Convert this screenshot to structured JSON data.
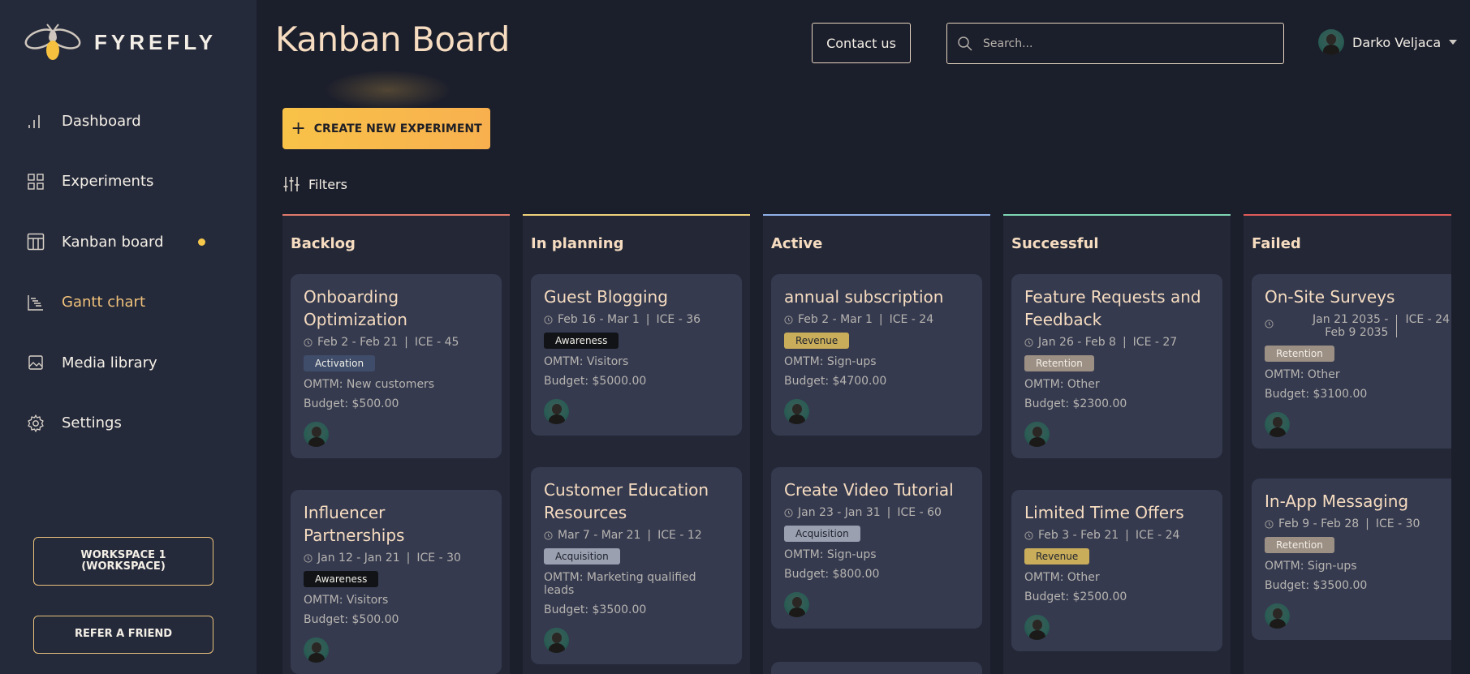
{
  "brand": {
    "name": "FYREFLY"
  },
  "sidebar": {
    "items": [
      {
        "label": "Dashboard",
        "icon": "bar-chart-icon"
      },
      {
        "label": "Experiments",
        "icon": "grid-icon"
      },
      {
        "label": "Kanban board",
        "icon": "kanban-icon",
        "active": true
      },
      {
        "label": "Gantt chart",
        "icon": "gantt-icon"
      },
      {
        "label": "Media library",
        "icon": "image-icon"
      },
      {
        "label": "Settings",
        "icon": "gear-icon"
      }
    ],
    "workspace_label": "WORKSPACE 1 (WORKSPACE)",
    "refer_label": "REFER A FRIEND"
  },
  "header": {
    "title": "Kanban Board",
    "contact_label": "Contact us",
    "search_placeholder": "Search...",
    "user_name": "Darko Veljaca"
  },
  "toolbar": {
    "create_label": "CREATE NEW EXPERIMENT",
    "filters_label": "Filters"
  },
  "colors": {
    "backlog": "#e07a6c",
    "planning": "#f0d27a",
    "active": "#8fb0e8",
    "successful": "#7fd6b4",
    "failed": "#e05a5a",
    "accent": "#f8b94c"
  },
  "columns": [
    {
      "title": "Backlog",
      "cards": [
        {
          "title": "Onboarding Optimization",
          "dates": "Feb 2 - Feb 21",
          "ice": "ICE - 45",
          "badge": "Activation",
          "omtm": "OMTM: New customers",
          "budget": "Budget: $500.00"
        },
        {
          "title": "Influencer Partnerships",
          "dates": "Jan 12 - Jan 21",
          "ice": "ICE - 30",
          "badge": "Awareness",
          "omtm": "OMTM: Visitors",
          "budget": "Budget: $500.00"
        }
      ]
    },
    {
      "title": "In planning",
      "cards": [
        {
          "title": "Guest Blogging",
          "dates": "Feb 16 - Mar 1",
          "ice": "ICE - 36",
          "badge": "Awareness",
          "omtm": "OMTM: Visitors",
          "budget": "Budget: $5000.00"
        },
        {
          "title": "Customer Education Resources",
          "dates": "Mar 7 - Mar 21",
          "ice": "ICE - 12",
          "badge": "Acquisition",
          "omtm": "OMTM: Marketing qualified leads",
          "budget": "Budget: $3500.00"
        }
      ]
    },
    {
      "title": "Active",
      "cards": [
        {
          "title": "annual subscription",
          "dates": "Feb 2 - Mar 1",
          "ice": "ICE - 24",
          "badge": "Revenue",
          "omtm": "OMTM: Sign-ups",
          "budget": "Budget: $4700.00"
        },
        {
          "title": "Create Video Tutorial",
          "dates": "Jan 23 - Jan 31",
          "ice": "ICE - 60",
          "badge": "Acquisition",
          "omtm": "OMTM: Sign-ups",
          "budget": "Budget: $800.00"
        }
      ]
    },
    {
      "title": "Successful",
      "cards": [
        {
          "title": "Feature Requests and Feedback",
          "dates": "Jan 26 - Feb 8",
          "ice": "ICE - 27",
          "badge": "Retention",
          "omtm": "OMTM: Other",
          "budget": "Budget: $2300.00"
        },
        {
          "title": "Limited Time Offers",
          "dates": "Feb 3 - Feb 21",
          "ice": "ICE - 24",
          "badge": "Revenue",
          "omtm": "OMTM: Other",
          "budget": "Budget: $2500.00"
        }
      ]
    },
    {
      "title": "Failed",
      "cards": [
        {
          "title": "On-Site Surveys",
          "dates": "Jan 21 2035 - Feb 9 2035",
          "ice": "ICE - 24",
          "badge": "Retention",
          "omtm": "OMTM: Other",
          "budget": "Budget: $3100.00"
        },
        {
          "title": "In-App Messaging",
          "dates": "Feb 9 - Feb 28",
          "ice": "ICE - 30",
          "badge": "Retention",
          "omtm": "OMTM: Sign-ups",
          "budget": "Budget: $3500.00"
        }
      ]
    }
  ]
}
